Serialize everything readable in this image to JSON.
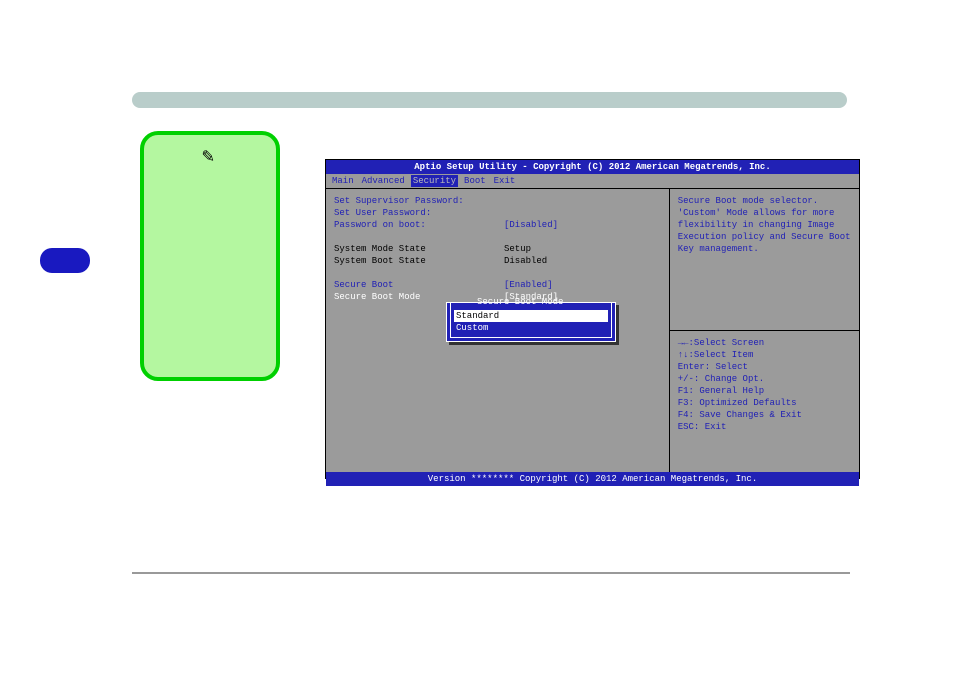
{
  "bios": {
    "title": "Aptio Setup Utility - Copyright (C) 2012 American Megatrends, Inc.",
    "footer": "Version ******** Copyright (C) 2012 American Megatrends, Inc.",
    "tabs": {
      "main": "Main",
      "advanced": "Advanced",
      "security": "Security",
      "boot": "Boot",
      "exit": "Exit"
    },
    "left": {
      "set_supervisor_password": "Set Supervisor Password:",
      "set_user_password": "Set User Password:",
      "password_on_boot_label": "Password on boot:",
      "password_on_boot_value": "[Disabled]",
      "system_mode_state_label": "System Mode State",
      "system_mode_state_value": "Setup",
      "system_boot_state_label": "System Boot State",
      "system_boot_state_value": "Disabled",
      "secure_boot_label": "Secure Boot",
      "secure_boot_value": "[Enabled]",
      "secure_boot_mode_label": "Secure Boot Mode",
      "secure_boot_mode_value": "[Standard]"
    },
    "popup": {
      "title": "Secure Boot Mode",
      "options": {
        "standard": "Standard",
        "custom": "Custom"
      }
    },
    "help": "Secure Boot mode selector. 'Custom' Mode allows for more flexibility in changing Image Execution policy and Secure Boot Key management.",
    "keys": {
      "select_screen": "→←:Select Screen",
      "select_item": "↑↓:Select Item",
      "enter": "Enter: Select",
      "change": "+/-: Change Opt.",
      "f1": "F1: General Help",
      "f3": "F3: Optimized Defaults",
      "f4": "F4: Save Changes & Exit",
      "esc": "ESC: Exit"
    }
  }
}
